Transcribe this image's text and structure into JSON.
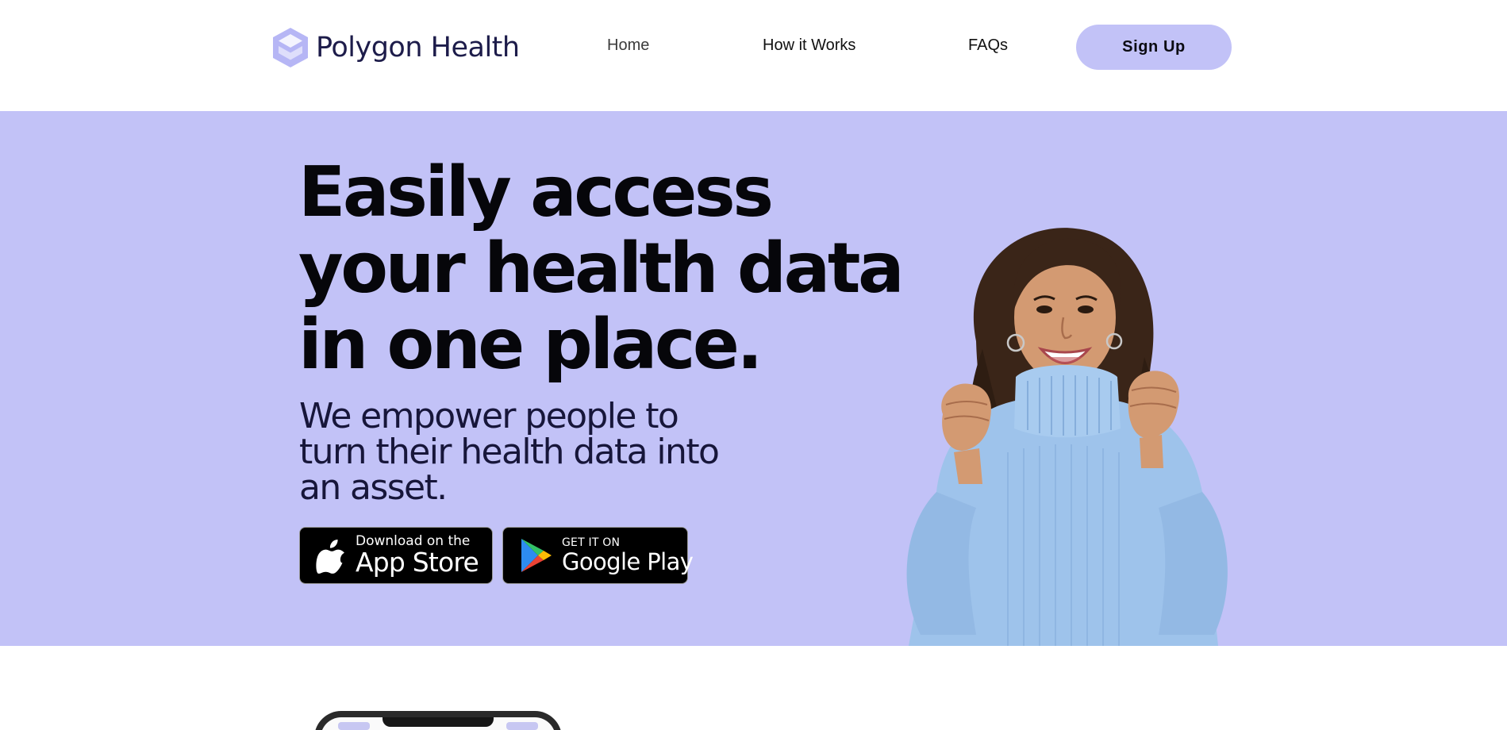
{
  "brand": {
    "name": "Polygon Health",
    "logo_color": "#b6b6f5",
    "text_color": "#1d1c4a"
  },
  "nav": {
    "items": [
      {
        "label": "Home"
      },
      {
        "label": "How it Works"
      },
      {
        "label": "FAQs"
      }
    ],
    "cta_label": "Sign Up",
    "cta_color": "#c2c2f7"
  },
  "hero": {
    "background": "#c2c2f7",
    "title_lines": [
      "Easily access",
      "your health data",
      "in one place."
    ],
    "subtitle_lines": [
      "We empower people to",
      "turn their health data into",
      "an asset."
    ],
    "photo_alt": "smiling woman in blue sweater",
    "stores": {
      "app_store": {
        "small": "Download on the",
        "big": "App Store",
        "icon": "apple-icon"
      },
      "google_play": {
        "small": "GET IT ON",
        "big": "Google Play",
        "icon": "google-play-icon"
      }
    }
  }
}
